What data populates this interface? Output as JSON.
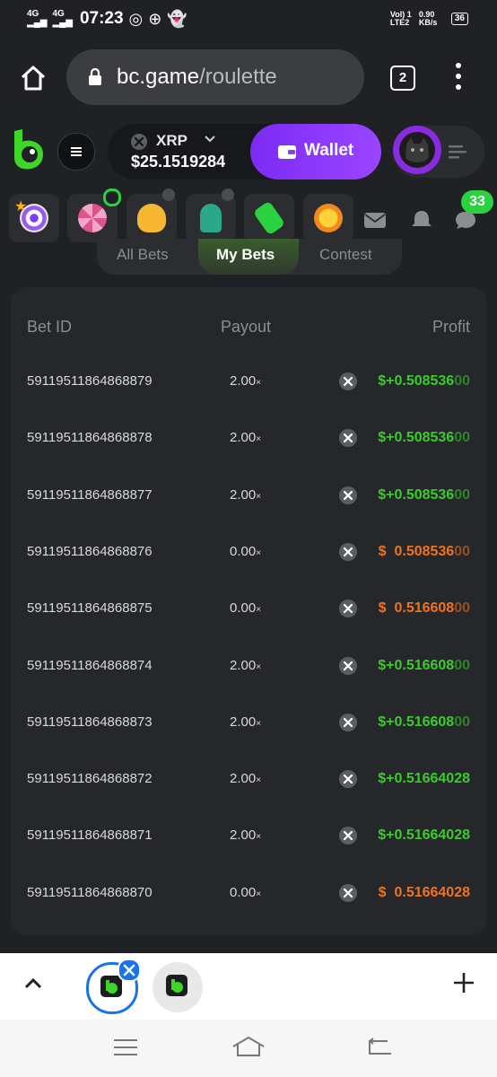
{
  "status_bar": {
    "network_left": "4G",
    "network_right": "4G",
    "time": "07:23",
    "lte_label": "Vol) 1 LTE2",
    "speed": "0.90 KB/s",
    "battery": "36"
  },
  "browser": {
    "url_host": "bc.game",
    "url_path": "/roulette",
    "tab_count": "2"
  },
  "header": {
    "currency": "XRP",
    "balance": "$25.1519284",
    "wallet_label": "Wallet"
  },
  "icon_row": {
    "notification_count": "33"
  },
  "tabs": {
    "all_bets": "All Bets",
    "my_bets": "My Bets",
    "contest": "Contest"
  },
  "table": {
    "headers": {
      "bet_id": "Bet ID",
      "payout": "Payout",
      "profit": "Profit"
    },
    "rows": [
      {
        "bet_id": "59119511864868879",
        "payout": "2.00",
        "payout_unit": "×",
        "sign": "$+",
        "profit": "0.508536",
        "profit_tail": "00",
        "win": true
      },
      {
        "bet_id": "59119511864868878",
        "payout": "2.00",
        "payout_unit": "×",
        "sign": "$+",
        "profit": "0.508536",
        "profit_tail": "00",
        "win": true
      },
      {
        "bet_id": "59119511864868877",
        "payout": "2.00",
        "payout_unit": "×",
        "sign": "$+",
        "profit": "0.508536",
        "profit_tail": "00",
        "win": true
      },
      {
        "bet_id": "59119511864868876",
        "payout": "0.00",
        "payout_unit": "×",
        "sign": "$",
        "profit": "0.508536",
        "profit_tail": "00",
        "win": false
      },
      {
        "bet_id": "59119511864868875",
        "payout": "0.00",
        "payout_unit": "×",
        "sign": "$",
        "profit": "0.516608",
        "profit_tail": "00",
        "win": false
      },
      {
        "bet_id": "59119511864868874",
        "payout": "2.00",
        "payout_unit": "×",
        "sign": "$+",
        "profit": "0.516608",
        "profit_tail": "00",
        "win": true
      },
      {
        "bet_id": "59119511864868873",
        "payout": "2.00",
        "payout_unit": "×",
        "sign": "$+",
        "profit": "0.516608",
        "profit_tail": "00",
        "win": true
      },
      {
        "bet_id": "59119511864868872",
        "payout": "2.00",
        "payout_unit": "×",
        "sign": "$+",
        "profit": "0.51664028",
        "profit_tail": "",
        "win": true
      },
      {
        "bet_id": "59119511864868871",
        "payout": "2.00",
        "payout_unit": "×",
        "sign": "$+",
        "profit": "0.51664028",
        "profit_tail": "",
        "win": true
      },
      {
        "bet_id": "59119511864868870",
        "payout": "0.00",
        "payout_unit": "×",
        "sign": "$",
        "profit": "0.51664028",
        "profit_tail": "",
        "win": false
      }
    ]
  },
  "colors": {
    "win": "#3ccb2c",
    "loss": "#f0731f",
    "wallet": "#8a3cf7",
    "background": "#1f2125",
    "card": "#25272b"
  }
}
